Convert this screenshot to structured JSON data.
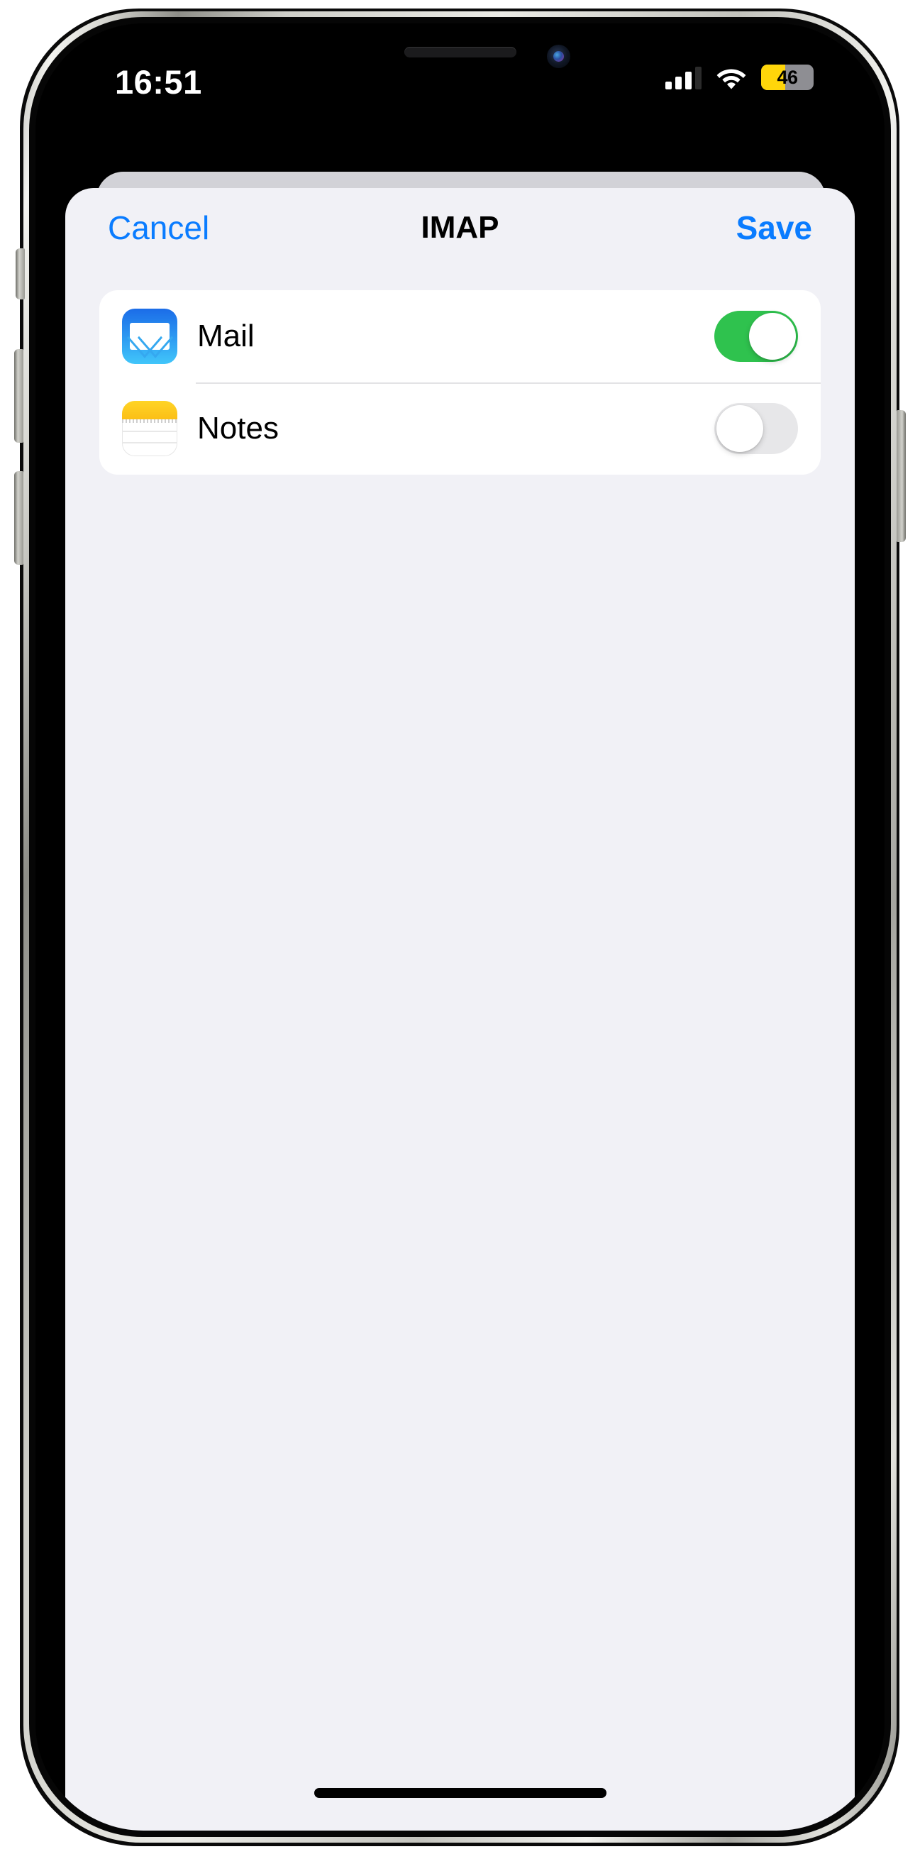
{
  "device": {
    "kind": "iphone-notch",
    "frame_color": "#c9c9c3",
    "screen_background": "#000000"
  },
  "status_bar": {
    "time": "16:51",
    "cellular": {
      "icon": "signal-bars-icon",
      "bars_total": 4,
      "bars_filled": 3
    },
    "wifi": {
      "icon": "wifi-icon",
      "strength": 3
    },
    "battery": {
      "icon": "battery-icon",
      "percent_label": "46",
      "percent_value": 46,
      "low_power_mode": true,
      "fill_color": "#ffd60a",
      "track_color": "#8e8e93"
    }
  },
  "sheet": {
    "background": "#f1f1f6",
    "behind_card_color": "#d1d1d6",
    "navbar": {
      "cancel_label": "Cancel",
      "title": "IMAP",
      "save_label": "Save",
      "tint_color": "#0a7cff",
      "title_color": "#000000"
    },
    "list": {
      "background": "#ffffff",
      "separator_color": "#e3e3e5",
      "rows": [
        {
          "id": "mail",
          "label": "Mail",
          "icon": "mail-app-icon",
          "icon_colors": {
            "top": "#1b6ce8",
            "bottom": "#41c6fa",
            "glyph": "#ffffff"
          },
          "toggle": {
            "state": "on",
            "state_label": "On",
            "on_color": "#2fc24e",
            "knob_color": "#ffffff"
          }
        },
        {
          "id": "notes",
          "label": "Notes",
          "icon": "notes-app-icon",
          "icon_colors": {
            "top": "#ffd426",
            "body": "#ffffff",
            "rule": "#e8e8e8"
          },
          "toggle": {
            "state": "off",
            "state_label": "Off",
            "off_color": "#e7e7e9",
            "knob_color": "#ffffff"
          }
        }
      ]
    }
  },
  "home_indicator": {
    "color": "#000000"
  }
}
